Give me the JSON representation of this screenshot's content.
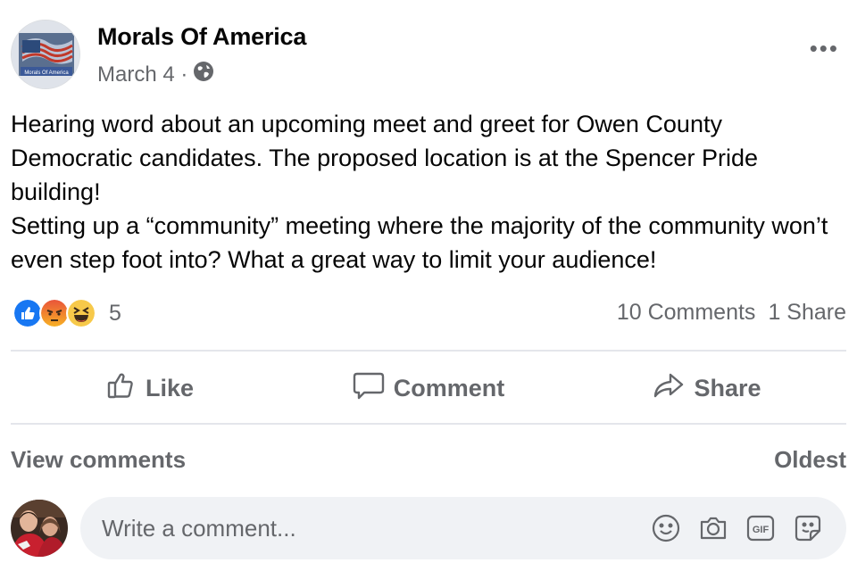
{
  "post": {
    "page_name": "Morals Of America",
    "avatar_caption": "Morals Of America",
    "date": "March 4 ·",
    "more_label": "•••",
    "text_lines": [
      "Hearing word about an upcoming meet and greet for Owen County Democratic candidates. The proposed location is at the Spencer Pride building!",
      "Setting up a “community” meeting where the majority of the community won’t even step foot into? What a great way to limit your audience!"
    ]
  },
  "reactions": {
    "icons": [
      "like-reaction-icon",
      "angry-reaction-icon",
      "haha-reaction-icon"
    ],
    "count": "5"
  },
  "stats": {
    "comments": "10 Comments",
    "shares": "1 Share"
  },
  "actions": {
    "like": "Like",
    "comment": "Comment",
    "share": "Share"
  },
  "comments_section": {
    "view_comments": "View comments",
    "sort": "Oldest",
    "placeholder": "Write a comment...",
    "tools": [
      "emoji-icon",
      "camera-icon",
      "gif-icon",
      "sticker-icon"
    ]
  },
  "colors": {
    "like_blue": "#1877f2",
    "secondary_text": "#65676b",
    "input_bg": "#f0f2f5"
  }
}
